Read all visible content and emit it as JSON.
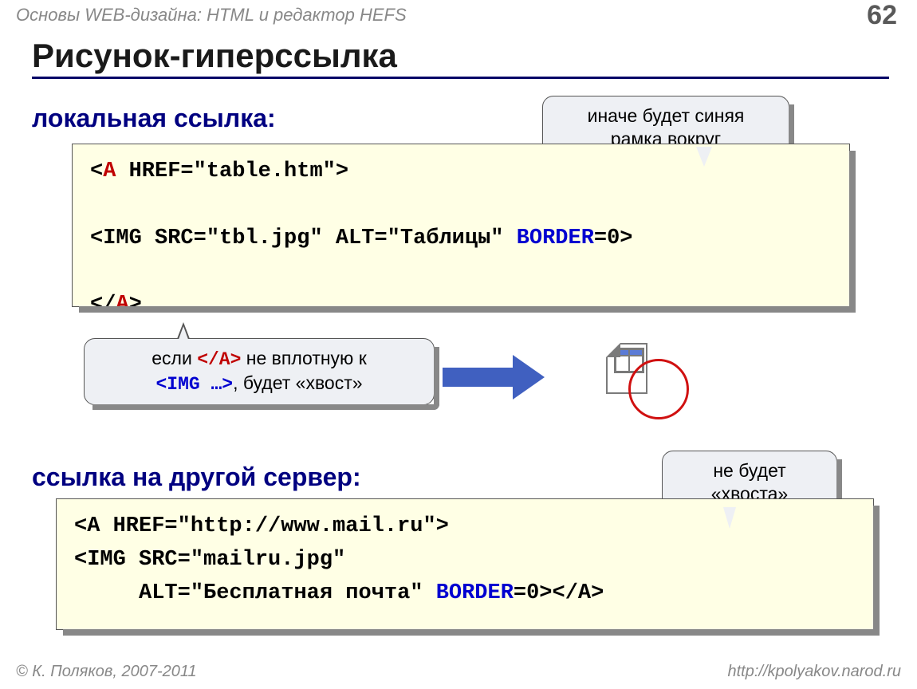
{
  "header": "Основы WEB-дизайна: HTML и редактор HEFS",
  "page_number": "62",
  "title": "Рисунок-гиперссылка",
  "section1": "локальная ссылка:",
  "section2": "ссылка на другой сервер:",
  "code1": {
    "l1a": "<",
    "l1b": "A",
    "l1c": " HREF=\"table.htm\">",
    "l2a": "<IMG SRC=\"tbl.jpg\" ALT=\"Таблицы\" ",
    "l2b": "BORDER",
    "l2c": "=0>",
    "l3a": "</",
    "l3b": "A",
    "l3c": ">"
  },
  "code2": {
    "l1": "<A HREF=\"http://www.mail.ru\">",
    "l2": "<IMG SRC=\"mailru.jpg\"",
    "l3a": "     ALT=\"Бесплатная почта\" ",
    "l3b": "BORDER",
    "l3c": "=0>",
    "l3d": "</A>"
  },
  "callouts": {
    "c1": "иначе будет синяя\nрамка вокруг",
    "c2_pre": "если ",
    "c2_tag1": "</A>",
    "c2_mid": " не вплотную к",
    "c2_tag2": "<IMG …>",
    "c2_post": ", будет «хвост»",
    "c3": "не будет\n«хвоста»"
  },
  "footer_left": "К. Поляков, 2007-2011",
  "footer_right": "http://kpolyakov.narod.ru"
}
